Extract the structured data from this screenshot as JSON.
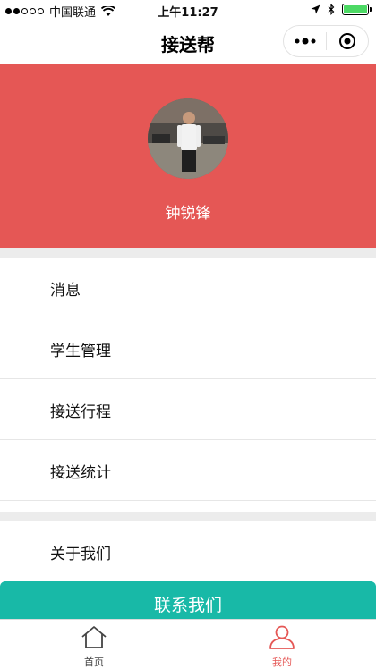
{
  "status_bar": {
    "carrier": "中国联通",
    "time": "上午11:27"
  },
  "nav": {
    "title": "接送帮"
  },
  "profile": {
    "name": "钟锐锋"
  },
  "menu": {
    "items": [
      {
        "label": "消息"
      },
      {
        "label": "学生管理"
      },
      {
        "label": "接送行程"
      },
      {
        "label": "接送统计"
      },
      {
        "label": "关于我们"
      }
    ],
    "contact_label": "联系我们"
  },
  "tabbar": {
    "tabs": [
      {
        "label": "首页",
        "icon": "home-icon"
      },
      {
        "label": "我的",
        "icon": "user-icon"
      }
    ],
    "active_color": "#e55755",
    "inactive_color": "#444444"
  },
  "colors": {
    "banner": "#e55755",
    "contact_button": "#18b9a7",
    "battery": "#4cd964"
  }
}
